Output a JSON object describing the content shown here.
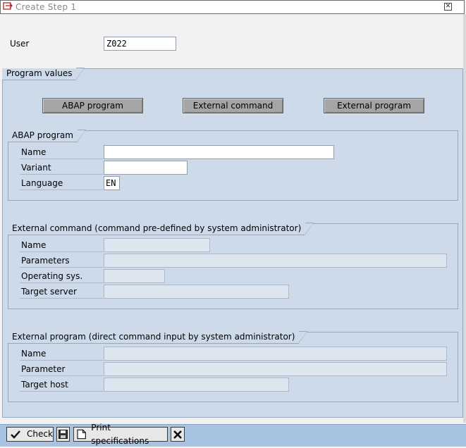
{
  "window": {
    "title": "Create Step  1",
    "close_glyph": "✕"
  },
  "user": {
    "label": "User",
    "value": "Z022"
  },
  "program_values": {
    "title": "Program values",
    "buttons": [
      "ABAP program",
      "External command",
      "External program"
    ]
  },
  "abap": {
    "title": "ABAP program",
    "name_label": "Name",
    "name_value": "",
    "variant_label": "Variant",
    "variant_value": "",
    "language_label": "Language",
    "language_value": "EN"
  },
  "ext_command": {
    "title": "External command (command pre-defined by system administrator)",
    "name_label": "Name",
    "name_value": "",
    "parameters_label": "Parameters",
    "parameters_value": "",
    "os_label": "Operating sys.",
    "os_value": "",
    "server_label": "Target server",
    "server_value": ""
  },
  "ext_program": {
    "title": "External program (direct command input by system administrator)",
    "name_label": "Name",
    "name_value": "",
    "parameter_label": "Parameter",
    "parameter_value": "",
    "host_label": "Target host",
    "host_value": ""
  },
  "toolbar": {
    "check_label": "Check",
    "print_label": "Print specifications"
  },
  "icons": {
    "check": "check-icon",
    "save": "save-icon",
    "print": "print-icon",
    "cancel": "cancel-icon"
  }
}
